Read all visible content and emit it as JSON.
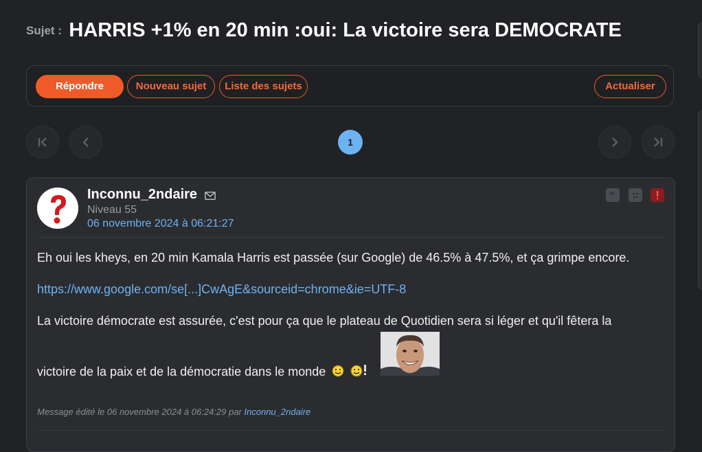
{
  "topic": {
    "prefix": "Sujet :",
    "title": "HARRIS +1% en 20 min :oui: La victoire sera DEMOCRATE"
  },
  "toolbar": {
    "reply": "Répondre",
    "new_topic": "Nouveau sujet",
    "topic_list": "Liste des sujets",
    "refresh": "Actualiser"
  },
  "pagination": {
    "current_page": "1",
    "first_icon": "first-page-icon",
    "prev_icon": "chevron-left-icon",
    "next_icon": "chevron-right-icon",
    "last_icon": "last-page-icon"
  },
  "post": {
    "author": "Inconnu_2ndaire",
    "level": "Niveau 55",
    "date": "06 novembre 2024 à 06:21:27",
    "paragraph1": "Eh oui les kheys, en 20 min Kamala Harris est passée (sur Google) de 46.5% à 47.5%, et ça grimpe encore.",
    "link": "https://www.google.com/se[...]CwAgE&sourceid=chrome&ie=UTF-8",
    "paragraph2": "La victoire démocrate est assurée, c'est pour ça que le plateau de Quotidien sera si léger et qu'il fêtera la",
    "paragraph3": "victoire de la paix et de la démocratie dans le monde",
    "edited_prefix": "Message édité le 06 novembre 2024 à 06:24:29 par",
    "edited_by": "Inconnu_2ndaire"
  },
  "colors": {
    "accent": "#f05a28",
    "link": "#6db3f2",
    "background": "#212225",
    "card": "#2b2c30"
  }
}
